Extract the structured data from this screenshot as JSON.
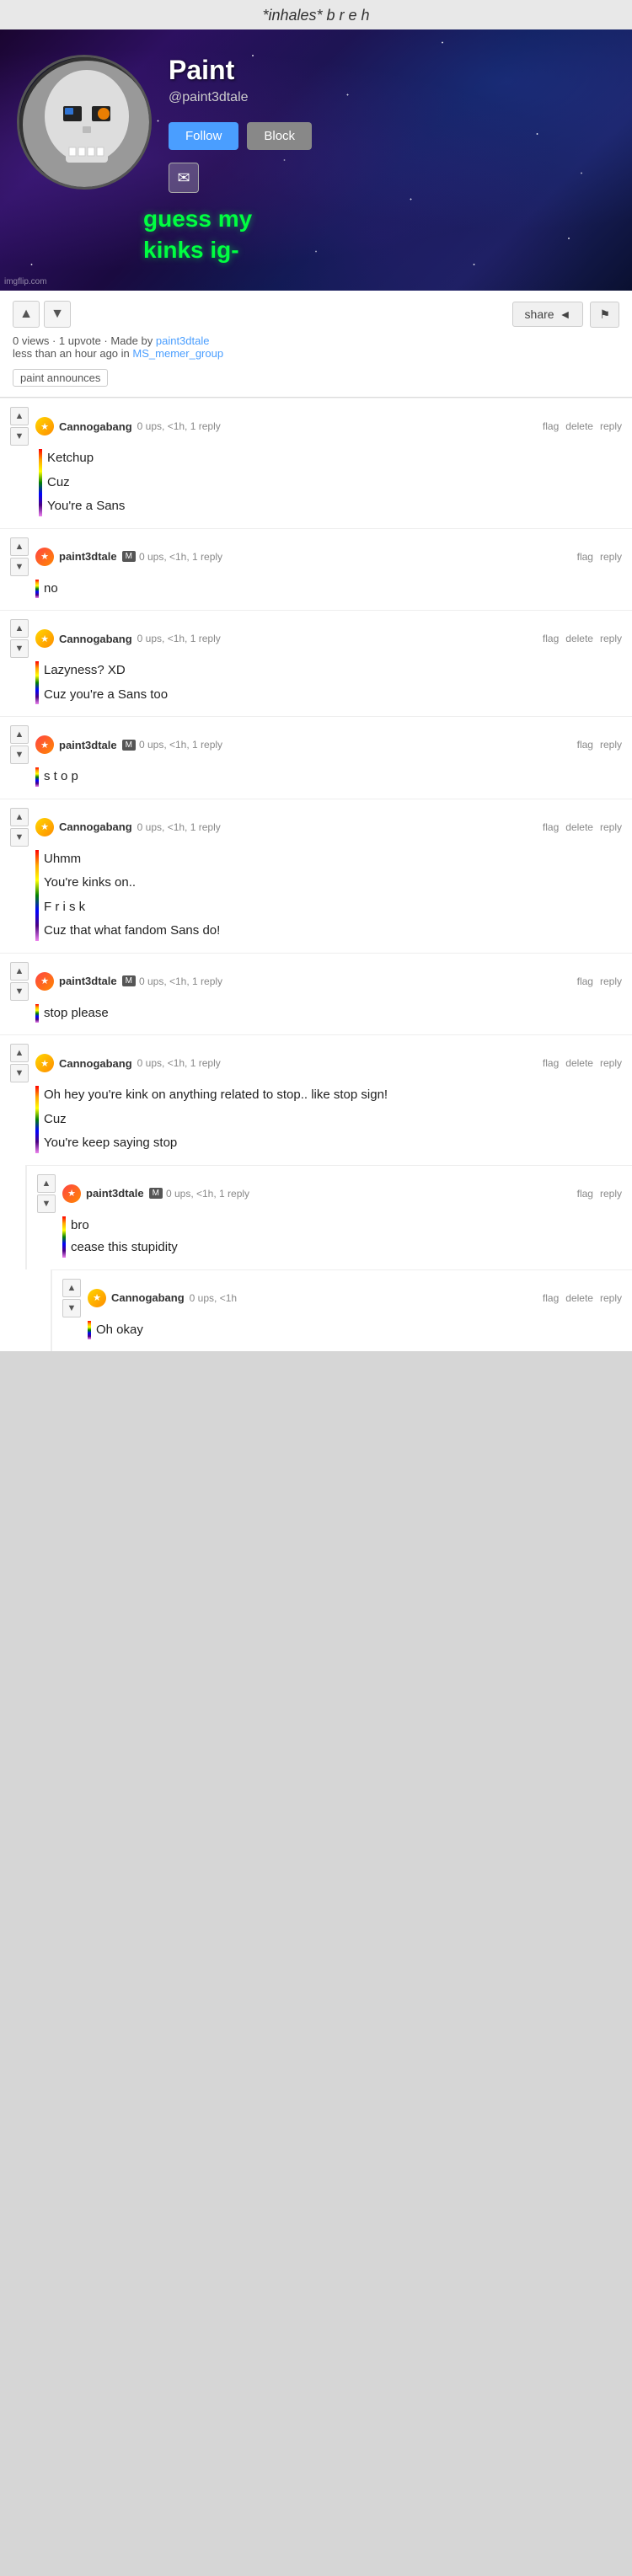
{
  "topText": "*inhales* b r e h",
  "profile": {
    "name": "Paint",
    "handle": "@paint3dtale",
    "bio": "guess my\nkinks ig-",
    "followLabel": "Follow",
    "blockLabel": "Block",
    "avatarAlt": "pixel skull avatar",
    "imgflipCredit": "imgflip.com"
  },
  "post": {
    "views": "0 views",
    "upvotes": "1 upvote",
    "madeBy": "Made by",
    "author": "paint3dtale",
    "timeAgo": "less than an hour ago in",
    "group": "MS_memer_group",
    "tag": "paint announces",
    "shareLabel": "share",
    "shareIcon": "◄",
    "flagIcon": "⚑"
  },
  "comments": [
    {
      "id": "c1",
      "user": "Cannogabang",
      "badge": null,
      "meta": "0 ups, <1h, 1 reply",
      "actions": [
        "flag",
        "delete",
        "reply"
      ],
      "colorBar": "rainbow",
      "lines": [
        "Ketchup",
        "",
        "Cuz",
        "",
        "You're a Sans"
      ],
      "replies": []
    },
    {
      "id": "c2",
      "user": "paint3dtale",
      "badge": "M",
      "meta": "0 ups, <1h, 1 reply",
      "actions": [
        "flag",
        "reply"
      ],
      "colorBar": "rainbow",
      "lines": [
        "no"
      ],
      "replies": []
    },
    {
      "id": "c3",
      "user": "Cannogabang",
      "badge": null,
      "meta": "0 ups, <1h, 1 reply",
      "actions": [
        "flag",
        "delete",
        "reply"
      ],
      "colorBar": "rainbow",
      "lines": [
        "Lazyness? XD",
        "",
        "Cuz you're a Sans too"
      ],
      "replies": []
    },
    {
      "id": "c4",
      "user": "paint3dtale",
      "badge": "M",
      "meta": "0 ups, <1h, 1 reply",
      "actions": [
        "flag",
        "reply"
      ],
      "colorBar": "rainbow",
      "lines": [
        "s t o p"
      ],
      "replies": []
    },
    {
      "id": "c5",
      "user": "Cannogabang",
      "badge": null,
      "meta": "0 ups, <1h, 1 reply",
      "actions": [
        "flag",
        "delete",
        "reply"
      ],
      "colorBar": "rainbow",
      "lines": [
        "Uhmm",
        "",
        "You're kinks on..",
        "",
        "F r i s k",
        "",
        "Cuz that what fandom Sans do!"
      ],
      "replies": []
    },
    {
      "id": "c6",
      "user": "paint3dtale",
      "badge": "M",
      "meta": "0 ups, <1h, 1 reply",
      "actions": [
        "flag",
        "reply"
      ],
      "colorBar": "rainbow",
      "lines": [
        "stop please"
      ],
      "replies": []
    },
    {
      "id": "c7",
      "user": "Cannogabang",
      "badge": null,
      "meta": "0 ups, <1h, 1 reply",
      "actions": [
        "flag",
        "delete",
        "reply"
      ],
      "colorBar": "rainbow",
      "lines": [
        "Oh hey you're kink on anything related to stop.. like stop sign!",
        "",
        "Cuz",
        "",
        "You're keep saying stop"
      ],
      "replies": []
    },
    {
      "id": "c8",
      "user": "paint3dtale",
      "badge": "M",
      "meta": "0 ups, <1h, 1 reply",
      "actions": [
        "flag",
        "reply"
      ],
      "colorBar": "rainbow",
      "lines": [
        "bro",
        "cease this stupidity"
      ],
      "replies": []
    },
    {
      "id": "c9",
      "user": "Cannogabang",
      "badge": null,
      "meta": "0 ups, <1h",
      "actions": [
        "flag",
        "delete",
        "reply"
      ],
      "colorBar": "rainbow",
      "lines": [
        "Oh okay"
      ],
      "replies": []
    }
  ]
}
